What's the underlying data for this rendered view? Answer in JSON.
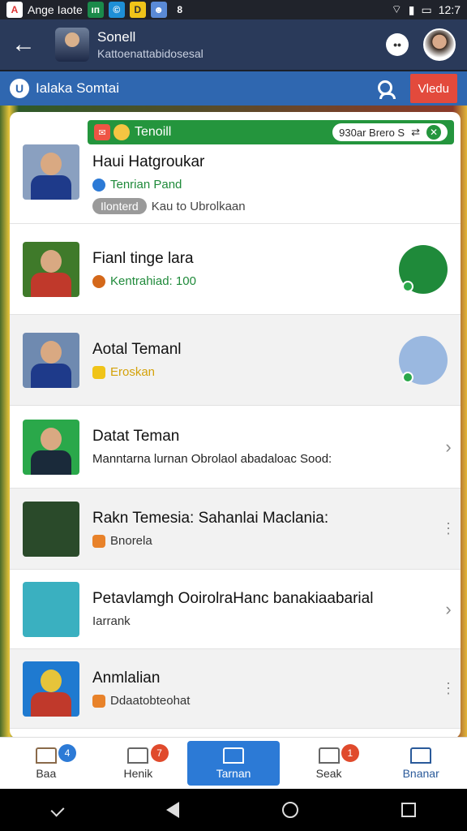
{
  "status_bar": {
    "left_text": "Ange Iaote",
    "time": "12:7"
  },
  "header": {
    "name": "Sonell",
    "subtitle": "Kattoenattabidosesal"
  },
  "searchbar": {
    "title": "Ialaka Somtai",
    "action_label": "Vledu"
  },
  "notification": {
    "title": "Tenoill",
    "pill_text": "930ar Brero S"
  },
  "items": [
    {
      "title": "Haui Hatgroukar",
      "sub": "Tenrian Pand",
      "status": "Ilonterd",
      "status_note": "Kau to Ubrolkaan",
      "sub_color": "#1f8a3a"
    },
    {
      "title": "Fianl tinge lara",
      "sub": "Kentrahiad: 100",
      "sub_color": "#1f8a3a"
    },
    {
      "title": "Aotal Temanl",
      "sub": "Eroskan",
      "sub_color": "#d4a20a"
    },
    {
      "title": "Datat Teman",
      "sub": "Manntarna lurnan Obrolaol abadaloac Sood:",
      "sub_color": "#222"
    },
    {
      "title": "Rakn Temesia: Sahanlai Maclania:",
      "sub": "Bnorela",
      "sub_color": "#333"
    },
    {
      "title": "Petavlamgh OoirolraHanc banakiaabarial",
      "sub": "Iarrank",
      "sub_color": "#333"
    },
    {
      "title": "Anmlalian",
      "sub": "Ddaatobteohat",
      "sub_color": "#333"
    }
  ],
  "bottom_nav": [
    {
      "label": "Baa",
      "badge": "4",
      "badge_color": "#2c7ad6"
    },
    {
      "label": "Henik",
      "badge": "7",
      "badge_color": "#e04a2c"
    },
    {
      "label": "Tarnan",
      "badge": ""
    },
    {
      "label": "Seak",
      "badge": "1",
      "badge_color": "#e04a2c"
    },
    {
      "label": "Bnanar",
      "badge": ""
    }
  ],
  "colors": {
    "header": "#2a3a5a",
    "search_bar": "#2f67b0",
    "accent_green": "#24953d",
    "nav_active": "#2c7ad6"
  }
}
